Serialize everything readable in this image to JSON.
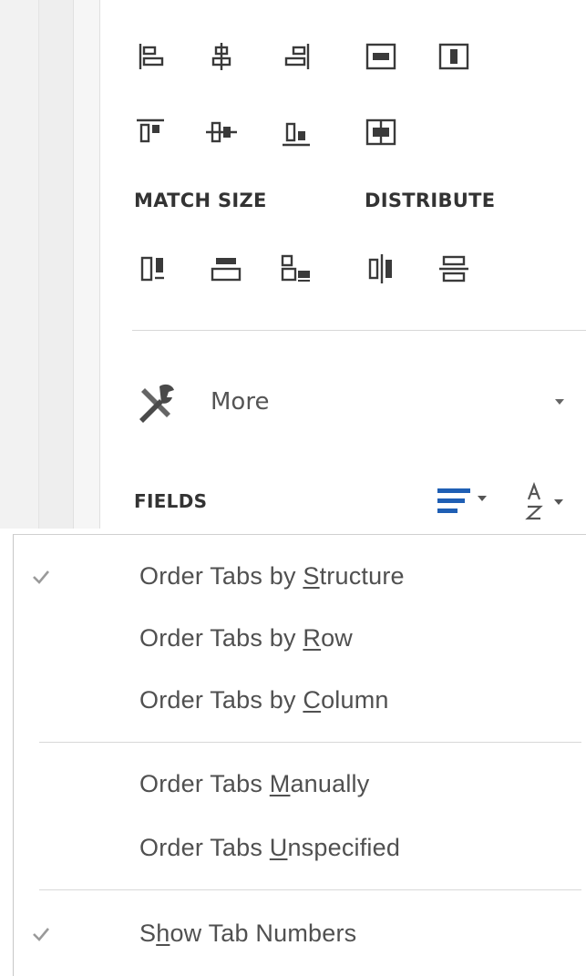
{
  "panel": {
    "match_size_label": "MATCH SIZE",
    "distribute_label": "DISTRIBUTE",
    "more_label": "More",
    "fields_label": "FIELDS"
  },
  "colors": {
    "accent_blue": "#1f5fb4",
    "icon_dark": "#3a3a3a",
    "check_gray": "#9a9a9a"
  },
  "menu": {
    "items": [
      {
        "pre": "Order Tabs by ",
        "key": "S",
        "post": "tructure",
        "checked": true
      },
      {
        "pre": "Order Tabs by ",
        "key": "R",
        "post": "ow",
        "checked": false
      },
      {
        "pre": "Order Tabs by ",
        "key": "C",
        "post": "olumn",
        "checked": false
      },
      {
        "pre": "Order Tabs ",
        "key": "M",
        "post": "anually",
        "checked": false
      },
      {
        "pre": "Order Tabs ",
        "key": "U",
        "post": "nspecified",
        "checked": false
      },
      {
        "pre": "S",
        "key": "h",
        "post": "ow Tab Numbers",
        "checked": true
      }
    ]
  }
}
